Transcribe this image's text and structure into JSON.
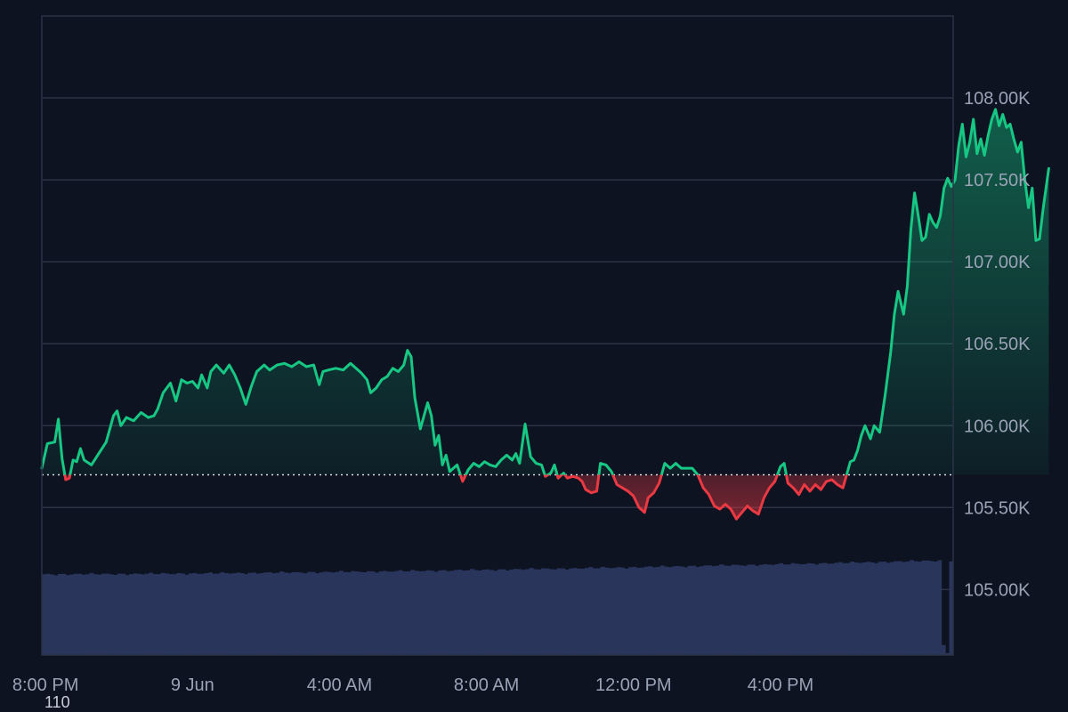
{
  "chart_data": {
    "type": "area",
    "baseline": 105700,
    "ylim": [
      104600,
      108500
    ],
    "yticks": [
      105000,
      105500,
      106000,
      106500,
      107000,
      107500,
      108000
    ],
    "ytick_labels": [
      "105.00K",
      "105.50K",
      "106.00K",
      "106.50K",
      "107.00K",
      "107.50K",
      "108.00K"
    ],
    "x_labels": [
      "8:00 PM",
      "9 Jun",
      "4:00 AM",
      "8:00 AM",
      "12:00 PM",
      "4:00 PM"
    ],
    "x_label_hours": [
      0,
      4,
      8,
      12,
      16,
      20
    ],
    "x_hour_range": [
      -0.1,
      24.7
    ],
    "points": [
      [
        -0.1,
        105740
      ],
      [
        0.05,
        105890
      ],
      [
        0.25,
        105900
      ],
      [
        0.35,
        106040
      ],
      [
        0.45,
        105800
      ],
      [
        0.55,
        105670
      ],
      [
        0.65,
        105680
      ],
      [
        0.75,
        105790
      ],
      [
        0.85,
        105780
      ],
      [
        0.95,
        105860
      ],
      [
        1.05,
        105790
      ],
      [
        1.25,
        105760
      ],
      [
        1.45,
        105830
      ],
      [
        1.65,
        105900
      ],
      [
        1.85,
        106060
      ],
      [
        1.95,
        106090
      ],
      [
        2.05,
        106000
      ],
      [
        2.2,
        106050
      ],
      [
        2.4,
        106030
      ],
      [
        2.6,
        106080
      ],
      [
        2.8,
        106050
      ],
      [
        2.95,
        106060
      ],
      [
        3.05,
        106100
      ],
      [
        3.2,
        106200
      ],
      [
        3.4,
        106260
      ],
      [
        3.55,
        106150
      ],
      [
        3.7,
        106280
      ],
      [
        3.85,
        106260
      ],
      [
        4.0,
        106270
      ],
      [
        4.15,
        106230
      ],
      [
        4.25,
        106310
      ],
      [
        4.4,
        106230
      ],
      [
        4.5,
        106330
      ],
      [
        4.65,
        106370
      ],
      [
        4.85,
        106320
      ],
      [
        5.0,
        106370
      ],
      [
        5.15,
        106310
      ],
      [
        5.3,
        106230
      ],
      [
        5.45,
        106130
      ],
      [
        5.6,
        106240
      ],
      [
        5.75,
        106330
      ],
      [
        5.95,
        106370
      ],
      [
        6.1,
        106340
      ],
      [
        6.3,
        106370
      ],
      [
        6.5,
        106380
      ],
      [
        6.7,
        106360
      ],
      [
        6.9,
        106390
      ],
      [
        7.1,
        106360
      ],
      [
        7.3,
        106370
      ],
      [
        7.45,
        106250
      ],
      [
        7.55,
        106330
      ],
      [
        7.7,
        106340
      ],
      [
        7.9,
        106350
      ],
      [
        8.1,
        106340
      ],
      [
        8.3,
        106380
      ],
      [
        8.45,
        106350
      ],
      [
        8.6,
        106320
      ],
      [
        8.75,
        106280
      ],
      [
        8.85,
        106200
      ],
      [
        9.0,
        106230
      ],
      [
        9.15,
        106280
      ],
      [
        9.3,
        106300
      ],
      [
        9.45,
        106350
      ],
      [
        9.6,
        106330
      ],
      [
        9.75,
        106370
      ],
      [
        9.85,
        106460
      ],
      [
        9.95,
        106420
      ],
      [
        10.05,
        106170
      ],
      [
        10.2,
        105980
      ],
      [
        10.3,
        106060
      ],
      [
        10.4,
        106140
      ],
      [
        10.5,
        106060
      ],
      [
        10.6,
        105880
      ],
      [
        10.7,
        105940
      ],
      [
        10.8,
        105760
      ],
      [
        10.9,
        105820
      ],
      [
        11.0,
        105720
      ],
      [
        11.2,
        105760
      ],
      [
        11.35,
        105660
      ],
      [
        11.5,
        105730
      ],
      [
        11.65,
        105770
      ],
      [
        11.8,
        105750
      ],
      [
        11.95,
        105780
      ],
      [
        12.1,
        105760
      ],
      [
        12.25,
        105750
      ],
      [
        12.4,
        105790
      ],
      [
        12.55,
        105820
      ],
      [
        12.7,
        105790
      ],
      [
        12.8,
        105830
      ],
      [
        12.9,
        105770
      ],
      [
        13.05,
        106010
      ],
      [
        13.2,
        105810
      ],
      [
        13.35,
        105770
      ],
      [
        13.5,
        105760
      ],
      [
        13.6,
        105690
      ],
      [
        13.75,
        105710
      ],
      [
        13.85,
        105760
      ],
      [
        13.95,
        105680
      ],
      [
        14.1,
        105710
      ],
      [
        14.2,
        105680
      ],
      [
        14.35,
        105690
      ],
      [
        14.5,
        105680
      ],
      [
        14.6,
        105660
      ],
      [
        14.7,
        105610
      ],
      [
        14.85,
        105590
      ],
      [
        15.0,
        105600
      ],
      [
        15.1,
        105770
      ],
      [
        15.25,
        105760
      ],
      [
        15.4,
        105720
      ],
      [
        15.55,
        105640
      ],
      [
        15.7,
        105620
      ],
      [
        15.85,
        105600
      ],
      [
        16.0,
        105570
      ],
      [
        16.15,
        105500
      ],
      [
        16.3,
        105470
      ],
      [
        16.4,
        105560
      ],
      [
        16.55,
        105590
      ],
      [
        16.7,
        105650
      ],
      [
        16.85,
        105770
      ],
      [
        17.0,
        105740
      ],
      [
        17.15,
        105770
      ],
      [
        17.3,
        105740
      ],
      [
        17.45,
        105740
      ],
      [
        17.6,
        105740
      ],
      [
        17.75,
        105700
      ],
      [
        17.9,
        105620
      ],
      [
        18.05,
        105580
      ],
      [
        18.2,
        105510
      ],
      [
        18.35,
        105490
      ],
      [
        18.5,
        105520
      ],
      [
        18.65,
        105490
      ],
      [
        18.8,
        105430
      ],
      [
        18.95,
        105470
      ],
      [
        19.1,
        105510
      ],
      [
        19.25,
        105480
      ],
      [
        19.4,
        105460
      ],
      [
        19.55,
        105560
      ],
      [
        19.7,
        105620
      ],
      [
        19.85,
        105660
      ],
      [
        20.0,
        105750
      ],
      [
        20.1,
        105770
      ],
      [
        20.2,
        105650
      ],
      [
        20.35,
        105620
      ],
      [
        20.5,
        105580
      ],
      [
        20.65,
        105640
      ],
      [
        20.8,
        105600
      ],
      [
        20.95,
        105640
      ],
      [
        21.1,
        105610
      ],
      [
        21.25,
        105660
      ],
      [
        21.4,
        105670
      ],
      [
        21.55,
        105640
      ],
      [
        21.7,
        105620
      ],
      [
        21.8,
        105700
      ],
      [
        21.9,
        105780
      ],
      [
        22.0,
        105790
      ],
      [
        22.1,
        105850
      ],
      [
        22.2,
        105940
      ],
      [
        22.3,
        106000
      ],
      [
        22.45,
        105920
      ],
      [
        22.55,
        106000
      ],
      [
        22.7,
        105960
      ],
      [
        22.85,
        106190
      ],
      [
        23.0,
        106450
      ],
      [
        23.1,
        106680
      ],
      [
        23.2,
        106820
      ],
      [
        23.35,
        106680
      ],
      [
        23.45,
        106850
      ],
      [
        23.55,
        107200
      ],
      [
        23.65,
        107420
      ],
      [
        23.75,
        107280
      ],
      [
        23.85,
        107130
      ],
      [
        23.95,
        107150
      ],
      [
        24.05,
        107290
      ],
      [
        24.15,
        107240
      ],
      [
        24.25,
        107210
      ],
      [
        24.35,
        107280
      ],
      [
        24.45,
        107450
      ],
      [
        24.55,
        107510
      ],
      [
        24.65,
        107460
      ],
      [
        24.75,
        107500
      ],
      [
        24.85,
        107710
      ],
      [
        24.95,
        107840
      ],
      [
        25.05,
        107640
      ],
      [
        25.15,
        107730
      ],
      [
        25.25,
        107870
      ],
      [
        25.35,
        107660
      ],
      [
        25.45,
        107750
      ],
      [
        25.55,
        107650
      ],
      [
        25.65,
        107770
      ],
      [
        25.75,
        107870
      ],
      [
        25.85,
        107930
      ],
      [
        25.95,
        107830
      ],
      [
        26.05,
        107900
      ],
      [
        26.15,
        107820
      ],
      [
        26.25,
        107840
      ],
      [
        26.35,
        107750
      ],
      [
        26.45,
        107670
      ],
      [
        26.55,
        107730
      ],
      [
        26.65,
        107500
      ],
      [
        26.75,
        107330
      ],
      [
        26.85,
        107450
      ],
      [
        26.95,
        107130
      ],
      [
        27.05,
        107140
      ],
      [
        27.15,
        107330
      ],
      [
        27.3,
        107570
      ]
    ],
    "volume": {
      "rel_heights_start": 0.81,
      "rel_heights_end": 0.95,
      "last_bar_rel": 0.94
    },
    "footer_value": "110",
    "colors": {
      "background": "#0d1321",
      "up_line": "#17c784",
      "down_line": "#ea3943",
      "volume": "#2a355c",
      "grid": "#2b3345",
      "baseline": "#d9dde5",
      "tick_text": "#9aa3b5"
    }
  }
}
